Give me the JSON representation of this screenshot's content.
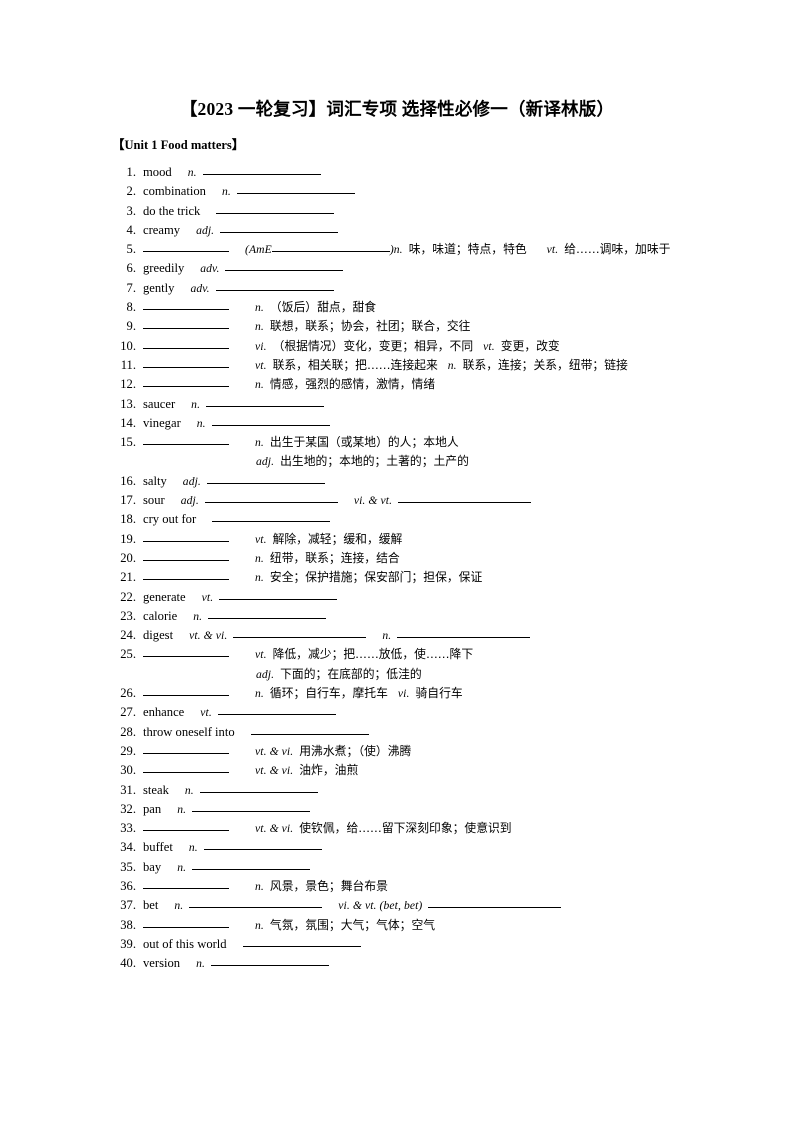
{
  "document": {
    "title": "【2023 一轮复习】词汇专项 选择性必修一（新译林版）",
    "unit_heading": "【Unit 1 Food matters】"
  },
  "entries": [
    {
      "num": "1.",
      "word": "mood",
      "pos1": "n.",
      "blank1": "md"
    },
    {
      "num": "2.",
      "word": "combination",
      "pos1": "n.",
      "blank1": "md"
    },
    {
      "num": "3.",
      "word": "do the trick",
      "pos1": "",
      "blank1": "md"
    },
    {
      "num": "4.",
      "word": "creamy",
      "pos1": "adj.",
      "blank1": "md"
    },
    {
      "num": "5.",
      "word": "",
      "pos1": "",
      "blank1": "sm",
      "extra": "(AmE",
      "extra_blank": "md",
      "extra_close": ")",
      "pos2": "n.",
      "cn2": "味，味道；特点，特色",
      "pos3": "vt.",
      "cn3": "给……调味，加味于"
    },
    {
      "num": "6.",
      "word": "greedily",
      "pos1": "adv.",
      "blank1": "md"
    },
    {
      "num": "7.",
      "word": "gently",
      "pos1": "adv.",
      "blank1": "md"
    },
    {
      "num": "8.",
      "word": "",
      "pos1": "n.",
      "blank1": "sm",
      "cn1": "（饭后）甜点，甜食"
    },
    {
      "num": "9.",
      "word": "",
      "pos1": "n.",
      "blank1": "sm",
      "cn1": "联想，联系；协会，社团；联合，交往"
    },
    {
      "num": "10.",
      "word": "",
      "pos1": "vi.",
      "blank1": "sm",
      "cn1": "（根据情况）变化，变更；相异，不同",
      "pos3": "vt.",
      "cn3": "变更，改变"
    },
    {
      "num": "11.",
      "word": "",
      "pos1": "vt.",
      "blank1": "sm",
      "cn1": "联系，相关联；把……连接起来",
      "pos3": "n.",
      "cn3": "联系，连接；关系，纽带；链接"
    },
    {
      "num": "12.",
      "word": "",
      "pos1": "n.",
      "blank1": "sm",
      "cn1": "情感，强烈的感情，激情，情绪"
    },
    {
      "num": "13.",
      "word": "saucer",
      "pos1": "n.",
      "blank1": "md"
    },
    {
      "num": "14.",
      "word": "vinegar",
      "pos1": "n.",
      "blank1": "md"
    },
    {
      "num": "15.",
      "word": "",
      "pos1": "n.",
      "blank1": "sm",
      "cn1": "出生于某国（或某地）的人；本地人",
      "sub_pos": "adj.",
      "sub_cn": "出生地的；本地的；土著的；土产的"
    },
    {
      "num": "16.",
      "word": "salty",
      "pos1": "adj.",
      "blank1": "md"
    },
    {
      "num": "17.",
      "word": "sour",
      "pos1": "adj.",
      "blank1": "lg",
      "pos2b": "vi. & vt.",
      "blank2": "lg"
    },
    {
      "num": "18.",
      "word": "cry out for",
      "pos1": "",
      "blank1": "md"
    },
    {
      "num": "19.",
      "word": "",
      "pos1": "vt.",
      "blank1": "sm",
      "cn1": "解除，减轻；缓和，缓解"
    },
    {
      "num": "20.",
      "word": "",
      "pos1": "n.",
      "blank1": "sm",
      "cn1": "纽带，联系；连接，结合"
    },
    {
      "num": "21.",
      "word": "",
      "pos1": "n.",
      "blank1": "sm",
      "cn1": "安全；保护措施；保安部门；担保，保证"
    },
    {
      "num": "22.",
      "word": "generate",
      "pos1": "vt.",
      "blank1": "md"
    },
    {
      "num": "23.",
      "word": "calorie",
      "pos1": "n.",
      "blank1": "md"
    },
    {
      "num": "24.",
      "word": "digest",
      "pos1": "vt. & vi.",
      "blank1": "lg",
      "pos2b": "n.",
      "blank2": "lg"
    },
    {
      "num": "25.",
      "word": "",
      "pos1": "vt.",
      "blank1": "sm",
      "cn1": "降低，减少；把……放低，使……降下",
      "sub_pos": "adj.",
      "sub_cn": "下面的；在底部的；低洼的"
    },
    {
      "num": "26.",
      "word": "",
      "pos1": "n.",
      "blank1": "sm",
      "cn1": "循环；自行车，摩托车",
      "pos3": "vi.",
      "cn3": "骑自行车"
    },
    {
      "num": "27.",
      "word": "enhance",
      "pos1": "vt.",
      "blank1": "md"
    },
    {
      "num": "28.",
      "word": "throw oneself into",
      "pos1": "",
      "blank1": "md"
    },
    {
      "num": "29.",
      "word": "",
      "pos1": "vt. & vi.",
      "blank1": "sm",
      "cn1": "用沸水煮；（使）沸腾"
    },
    {
      "num": "30.",
      "word": "",
      "pos1": "vt. & vi.",
      "blank1": "sm",
      "cn1": "油炸，油煎"
    },
    {
      "num": "31.",
      "word": "steak",
      "pos1": "n.",
      "blank1": "md"
    },
    {
      "num": "32.",
      "word": "pan",
      "pos1": "n.",
      "blank1": "md"
    },
    {
      "num": "33.",
      "word": "",
      "pos1": "vt. & vi.",
      "blank1": "sm",
      "cn1": "使钦佩，给……留下深刻印象；使意识到"
    },
    {
      "num": "34.",
      "word": "buffet",
      "pos1": "n.",
      "blank1": "md"
    },
    {
      "num": "35.",
      "word": "bay",
      "pos1": "n.",
      "blank1": "md"
    },
    {
      "num": "36.",
      "word": "",
      "pos1": "n.",
      "blank1": "sm",
      "cn1": "风景，景色；舞台布景"
    },
    {
      "num": "37.",
      "word": "bet",
      "pos1": "n.",
      "blank1": "lg",
      "pos2b": "vi. & vt. (bet, bet)",
      "blank2": "lg"
    },
    {
      "num": "38.",
      "word": "",
      "pos1": "n.",
      "blank1": "sm",
      "cn1": "气氛，氛围；大气；气体；空气"
    },
    {
      "num": "39.",
      "word": "out of this world",
      "pos1": "",
      "blank1": "md"
    },
    {
      "num": "40.",
      "word": "version",
      "pos1": "n.",
      "blank1": "md"
    }
  ]
}
